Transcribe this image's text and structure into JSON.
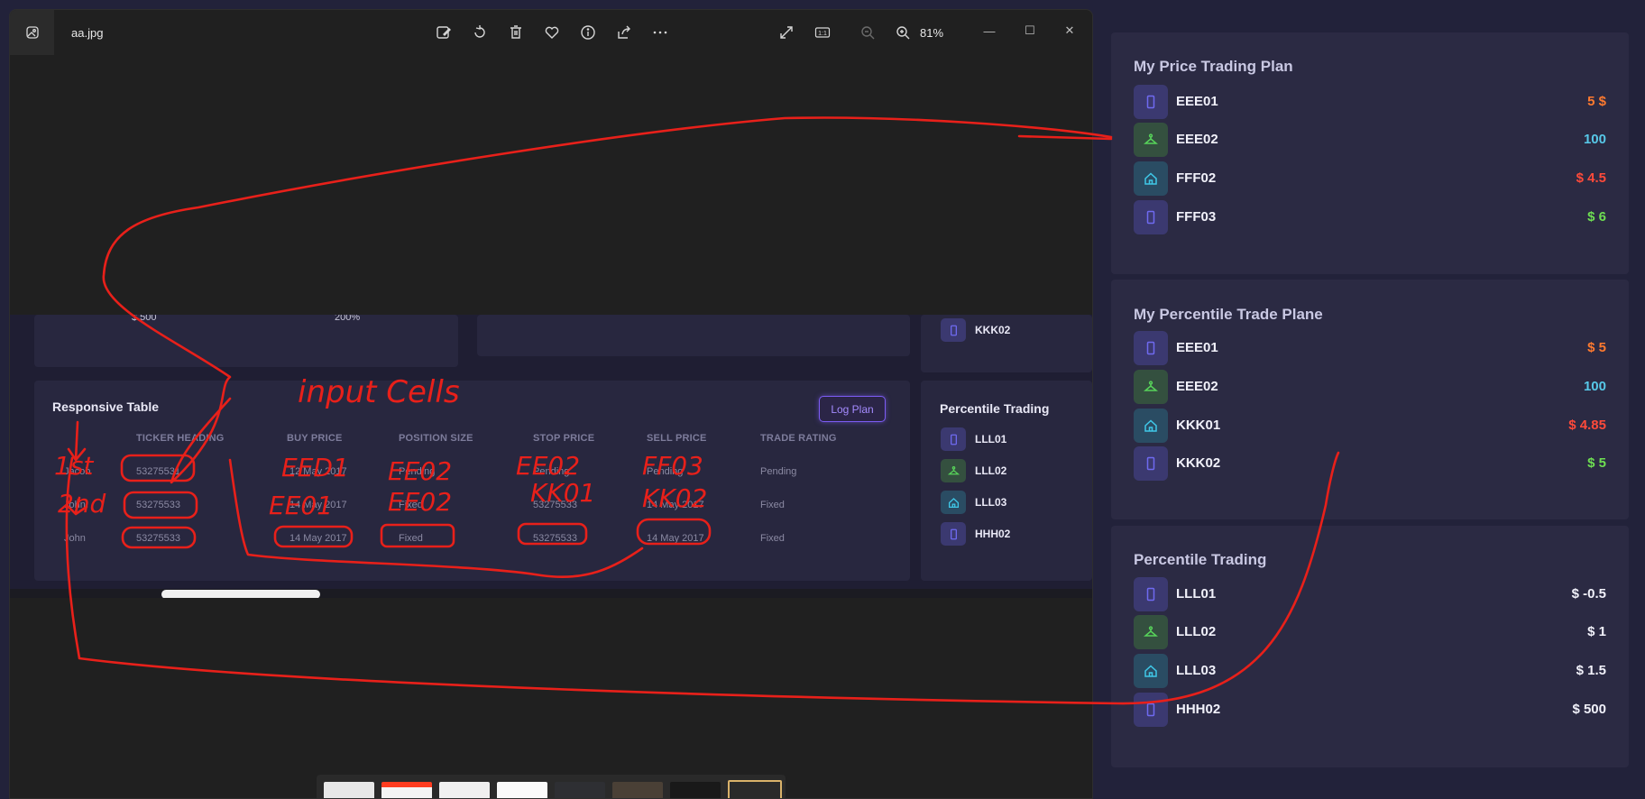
{
  "viewer": {
    "file_name": "aa.jpg",
    "zoom": "81%",
    "fit_label": "1:1"
  },
  "photo": {
    "top_values": [
      "$ 500",
      "200%"
    ],
    "top_right_item": "KKK02",
    "table_title": "Responsive Table",
    "log_button": "Log Plan",
    "headers": [
      "TICKER HEADING",
      "BUY PRICE",
      "POSITION SIZE",
      "STOP PRICE",
      "SELL PRICE",
      "TRADE RATING"
    ],
    "rows": [
      [
        "Jacob",
        "53275531",
        "12 May 2017",
        "Pending",
        "Pending",
        "Pending",
        "Pending"
      ],
      [
        "John",
        "53275533",
        "14 May 2017",
        "Fixed",
        "53275533",
        "14 May 2017",
        "Fixed"
      ],
      [
        "John",
        "53275533",
        "14 May 2017",
        "Fixed",
        "53275533",
        "14 May 2017",
        "Fixed"
      ]
    ],
    "side_title": "Percentile Trading",
    "side_items": [
      "LLL01",
      "LLL02",
      "LLL03",
      "HHH02"
    ]
  },
  "annotations": {
    "input_cells": "input Cells",
    "first": "1st",
    "second": "2nd",
    "r1": [
      "EED1",
      "EE02",
      "EE02",
      "FF03"
    ],
    "r2": [
      "EE01",
      "EE02",
      "KK01",
      "KK02"
    ]
  },
  "price_plan": {
    "title": "My Price Trading Plan",
    "items": [
      {
        "name": "EEE01",
        "value": "5 $",
        "icon": "phone-icon",
        "color": "#ff7a2f"
      },
      {
        "name": "EEE02",
        "value": "100",
        "icon": "hanger-icon",
        "color": "#57c8e8"
      },
      {
        "name": "FFF02",
        "value": "$ 4.5",
        "icon": "home-icon",
        "color": "#ff4a3a"
      },
      {
        "name": "FFF03",
        "value": "$ 6",
        "icon": "phone-icon",
        "color": "#6ede52"
      }
    ]
  },
  "percentile_plan": {
    "title": "My Percentile Trade Plane",
    "items": [
      {
        "name": "EEE01",
        "value": "$ 5",
        "icon": "phone-icon",
        "color": "#ff7a2f"
      },
      {
        "name": "EEE02",
        "value": "100",
        "icon": "hanger-icon",
        "color": "#57c8e8"
      },
      {
        "name": "KKK01",
        "value": "$ 4.85",
        "icon": "home-icon",
        "color": "#ff4a3a"
      },
      {
        "name": "KKK02",
        "value": "$ 5",
        "icon": "phone-icon",
        "color": "#6ede52"
      }
    ]
  },
  "percentile_trading": {
    "title": "Percentile Trading",
    "items": [
      {
        "name": "LLL01",
        "value": "$ -0.5",
        "icon": "phone-icon",
        "color": "#f1f1fa"
      },
      {
        "name": "LLL02",
        "value": "$ 1",
        "icon": "hanger-icon",
        "color": "#f1f1fa"
      },
      {
        "name": "LLL03",
        "value": "$ 1.5",
        "icon": "home-icon",
        "color": "#f1f1fa"
      },
      {
        "name": "HHH02",
        "value": "$ 500",
        "icon": "phone-icon",
        "color": "#f1f1fa"
      }
    ]
  }
}
